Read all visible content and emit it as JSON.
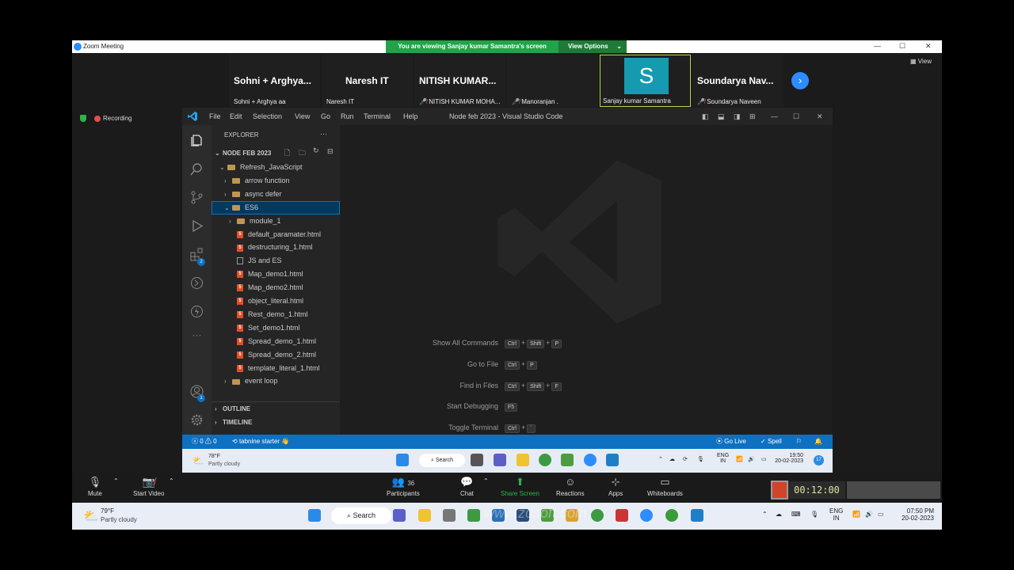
{
  "zoom": {
    "window_title": "Zoom Meeting",
    "banner": "You are viewing Sanjay kumar Samantra's screen",
    "view_options": "View Options",
    "view_label": "View",
    "recording_label": "Recording",
    "participants": [
      {
        "display": "Sohni + Arghya...",
        "label": "Sohni + Arghya aa",
        "muted": false
      },
      {
        "display": "Naresh IT",
        "label": "Naresh IT",
        "muted": false
      },
      {
        "display": "NITISH KUMAR...",
        "label": "NITISH KUMAR MOHA...",
        "muted": true
      },
      {
        "display": "",
        "label": "Manoranjan .",
        "muted": true
      },
      {
        "display": "S",
        "label": "Sanjay kumar Samantra",
        "muted": false,
        "active": true
      },
      {
        "display": "Soundarya Nav...",
        "label": "Soundarya Naveen",
        "muted": true
      }
    ],
    "toolbar": {
      "mute": "Mute",
      "start_video": "Start Video",
      "participants": "Participants",
      "participants_count": "36",
      "chat": "Chat",
      "share_screen": "Share Screen",
      "reactions": "Reactions",
      "apps": "Apps",
      "whiteboards": "Whiteboards"
    }
  },
  "vscode": {
    "menu": [
      "File",
      "Edit",
      "Selection",
      "View",
      "Go",
      "Run",
      "Terminal",
      "Help"
    ],
    "window_title": "Node feb 2023 - Visual Studio Code",
    "explorer_title": "EXPLORER",
    "project_name": "NODE FEB 2023",
    "tree": [
      {
        "label": "Refresh_JavaScript",
        "type": "folder",
        "open": true
      },
      {
        "label": "arrow function",
        "type": "folder",
        "open": false
      },
      {
        "label": "async defer",
        "type": "folder",
        "open": false
      },
      {
        "label": "ES6",
        "type": "folder",
        "open": true,
        "selected": true
      },
      {
        "label": "module_1",
        "type": "folder",
        "open": false
      },
      {
        "label": "default_paramater.html",
        "type": "html"
      },
      {
        "label": "destructuring_1.html",
        "type": "html"
      },
      {
        "label": "JS and ES",
        "type": "file"
      },
      {
        "label": "Map_demo1.html",
        "type": "html"
      },
      {
        "label": "Map_demo2.html",
        "type": "html"
      },
      {
        "label": "object_literal.html",
        "type": "html"
      },
      {
        "label": "Rest_demo_1.html",
        "type": "html"
      },
      {
        "label": "Set_demo1.html",
        "type": "html"
      },
      {
        "label": "Spread_demo_1.html",
        "type": "html"
      },
      {
        "label": "Spread_demo_2.html",
        "type": "html"
      },
      {
        "label": "template_literal_1.html",
        "type": "html"
      },
      {
        "label": "event loop",
        "type": "folder",
        "open": false
      }
    ],
    "outline": "OUTLINE",
    "timeline": "TIMELINE",
    "accounts_badge": "1",
    "extensions_badge": "2",
    "shortcuts": [
      {
        "label": "Show All Commands",
        "keys": [
          "Ctrl",
          "+",
          "Shift",
          "+",
          "P"
        ]
      },
      {
        "label": "Go to File",
        "keys": [
          "Ctrl",
          "+",
          "P"
        ]
      },
      {
        "label": "Find in Files",
        "keys": [
          "Ctrl",
          "+",
          "Shift",
          "+",
          "F"
        ]
      },
      {
        "label": "Start Debugging",
        "keys": [
          "F5"
        ]
      },
      {
        "label": "Toggle Terminal",
        "keys": [
          "Ctrl",
          "+",
          "`"
        ]
      }
    ],
    "status": {
      "errors": "0",
      "warnings": "0",
      "tabnine": "tabnine starter",
      "go_live": "Go Live",
      "spell": "Spell"
    }
  },
  "inner_taskbar": {
    "temp": "78°F",
    "weather": "Partly cloudy",
    "search": "Search",
    "lang": "ENG",
    "region": "IN",
    "time": "19:50",
    "date": "20-02-2023",
    "notif": "17"
  },
  "outer_taskbar": {
    "temp": "79°F",
    "weather": "Partly cloudy",
    "search": "Search",
    "lang": "ENG",
    "region": "IN",
    "time": "07:50 PM",
    "date": "20-02-2023",
    "watermark": "www.zdsoft.com",
    "recorder_time": "00:12:00"
  },
  "colors": {
    "banner_green": "#22a34a",
    "vscode_blue": "#0e70c0",
    "zoom_blue": "#2d8cff",
    "avatar_teal": "#159ab0"
  }
}
